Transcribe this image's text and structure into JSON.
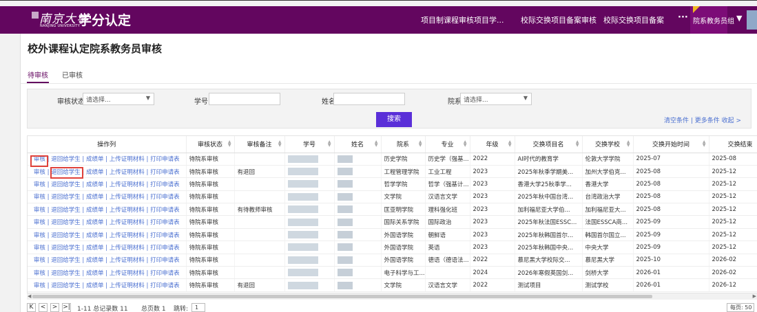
{
  "header": {
    "logo_cn": "南京大学",
    "logo_en": "NANJING UNIVERSITY",
    "app_title": "学分认定",
    "nav": [
      "项目制课程审核项目学...",
      "校际交换项目备案审核",
      "校际交换项目备案"
    ],
    "more": "···",
    "user_role": "院系教务员组",
    "user_caret": "▼"
  },
  "page": {
    "title": "校外课程认定院系教务员审核",
    "tabs": [
      "待审核",
      "已审核"
    ],
    "active_tab": "待审核"
  },
  "filters": {
    "status_label": "审核状态",
    "status_placeholder": "请选择...",
    "student_id_label": "学号",
    "name_label": "姓名",
    "dept_label": "院系",
    "dept_placeholder": "请选择...",
    "search_button": "搜索",
    "links": "清空条件 | 更多条件   收起 >"
  },
  "table": {
    "columns": [
      "操作列",
      "审核状态",
      "审核备注",
      "学号",
      "姓名",
      "院系",
      "专业",
      "年级",
      "交换项目名",
      "交换学校",
      "交换开始时间",
      "交换结束"
    ],
    "ops": [
      "审核",
      "退回给学生",
      "成绩单",
      "上传证明材料",
      "打印申请表"
    ],
    "rows": [
      {
        "status": "待院系审核",
        "remark": "",
        "dept": "历史学院",
        "major": "历史学（强基...",
        "grade": "2022",
        "project": "AI时代的教育学",
        "school": "伦敦大学学院",
        "start": "2025-07",
        "end": "2025-08"
      },
      {
        "status": "待院系审核",
        "remark": "有退回",
        "dept": "工程管理学院",
        "major": "工业工程",
        "grade": "2023",
        "project": "2025年秋季学期美...",
        "school": "加州大学伯克...",
        "start": "2025-08",
        "end": "2025-12"
      },
      {
        "status": "待院系审核",
        "remark": "",
        "dept": "哲学学院",
        "major": "哲学（强基计...",
        "grade": "2023",
        "project": "香港大学25秋季学...",
        "school": "香港大学",
        "start": "2025-08",
        "end": "2025-12"
      },
      {
        "status": "待院系审核",
        "remark": "",
        "dept": "文学院",
        "major": "汉语言文学",
        "grade": "2023",
        "project": "2025年秋中国台湾...",
        "school": "台湾政治大学",
        "start": "2025-08",
        "end": "2025-12"
      },
      {
        "status": "待院系审核",
        "remark": "有待教师审核",
        "dept": "匡亚明学院",
        "major": "理科强化班",
        "grade": "2023",
        "project": "加利福尼亚大学伯...",
        "school": "加利福尼亚大...",
        "start": "2025-08",
        "end": "2025-12"
      },
      {
        "status": "待院系审核",
        "remark": "",
        "dept": "国际关系学院",
        "major": "国际政治",
        "grade": "2023",
        "project": "2025年秋法国ESSC...",
        "school": "法国ESSCA商...",
        "start": "2025-09",
        "end": "2025-12"
      },
      {
        "status": "待院系审核",
        "remark": "",
        "dept": "外国语学院",
        "major": "朝鲜语",
        "grade": "2023",
        "project": "2025年秋韩国首尔...",
        "school": "韩国首尔国立...",
        "start": "2025-09",
        "end": "2025-12"
      },
      {
        "status": "待院系审核",
        "remark": "",
        "dept": "外国语学院",
        "major": "英语",
        "grade": "2023",
        "project": "2025年秋韩国中央...",
        "school": "中央大学",
        "start": "2025-09",
        "end": "2025-12"
      },
      {
        "status": "待院系审核",
        "remark": "",
        "dept": "外国语学院",
        "major": "德语（德语法...",
        "grade": "2022",
        "project": "慕尼黑大学校际交...",
        "school": "慕尼黑大学",
        "start": "2025-10",
        "end": "2026-02"
      },
      {
        "status": "待院系审核",
        "remark": "",
        "dept": "电子科学与工...",
        "major": "",
        "grade": "2024",
        "project": "2026年寒假英国剑...",
        "school": "剑桥大学",
        "start": "2026-01",
        "end": "2026-02"
      },
      {
        "status": "待院系审核",
        "remark": "有退回",
        "dept": "文学院",
        "major": "汉语言文学",
        "grade": "2022",
        "project": "测试项目",
        "school": "测试学校",
        "start": "2026-01",
        "end": "2026-12"
      }
    ]
  },
  "pager": {
    "first": "K",
    "prev": "<",
    "next": ">",
    "last": ">|",
    "summary": "1-11 总记录数 11",
    "pages": "总页数 1",
    "jump_label": "跳转:",
    "jump_value": "1",
    "per_page": "每页: 50"
  },
  "colors": {
    "brand": "#63065f",
    "accent_link": "#4a6fd0",
    "search_button": "#5a2fd8",
    "highlight": "#e0413a"
  }
}
